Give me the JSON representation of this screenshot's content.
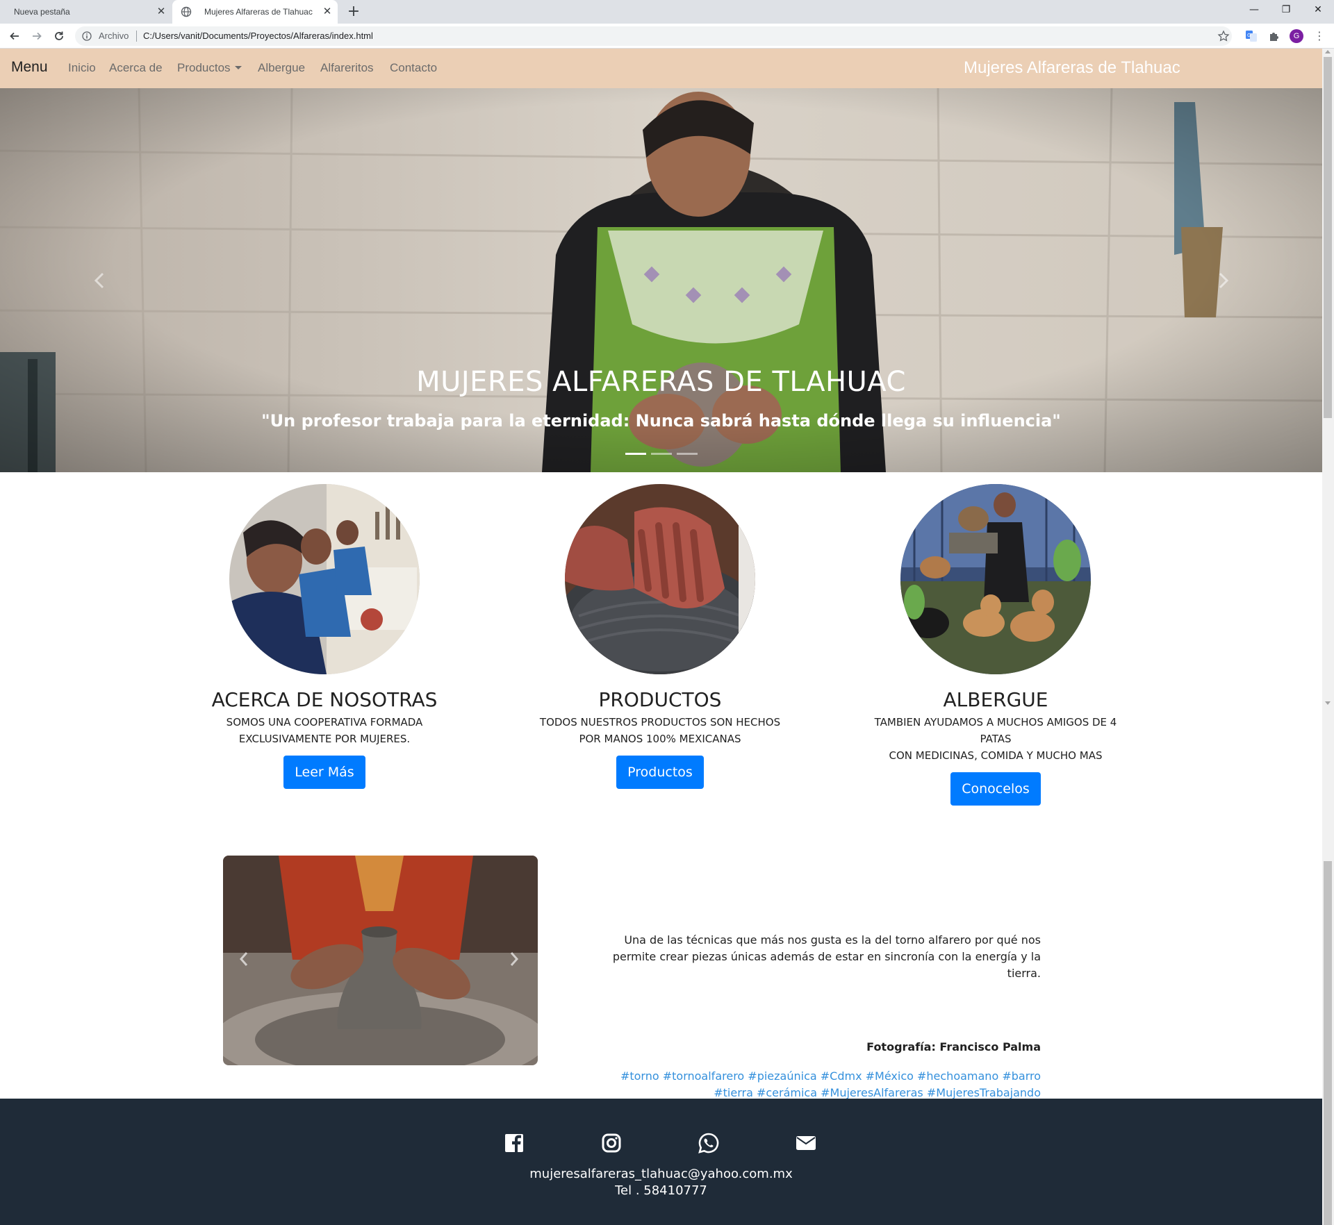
{
  "browser": {
    "tabs": [
      {
        "title": "Nueva pestaña"
      },
      {
        "title": "Mujeres Alfareras de Tlahuac"
      }
    ],
    "omnibox": {
      "scheme_label": "Archivo",
      "url": "C:/Users/vanit/Documents/Proyectos/Alfareras/index.html"
    },
    "profile_initial": "G"
  },
  "navbar": {
    "brand": "Menu",
    "links": [
      "Inicio",
      "Acerca de",
      "Productos",
      "Albergue",
      "Alfareritos",
      "Contacto"
    ],
    "site_title": "Mujeres Alfareras de Tlahuac",
    "background": "#ebcfb5"
  },
  "hero": {
    "title": "MUJERES ALFARERAS DE TLAHUAC",
    "quote": "\"Un profesor trabaja para la eternidad: Nunca sabrá hasta dónde llega su influencia\"",
    "slide_count": 3,
    "active_slide": 1
  },
  "features": [
    {
      "heading": "ACERCA DE NOSOTRAS",
      "lines": [
        "SOMOS UNA COOPERATIVA FORMADA",
        "EXCLUSIVAMENTE POR MUJERES."
      ],
      "button": "Leer Más"
    },
    {
      "heading": "PRODUCTOS",
      "lines": [
        "TODOS NUESTROS PRODUCTOS SON HECHOS",
        "POR MANOS 100% MEXICANAS"
      ],
      "button": "Productos"
    },
    {
      "heading": "ALBERGUE",
      "lines": [
        "TAMBIEN AYUDAMOS A MUCHOS AMIGOS DE 4",
        "PATAS",
        "CON MEDICINAS, COMIDA Y MUCHO MAS"
      ],
      "button": "Conocelos"
    }
  ],
  "technique": {
    "lines": [
      "Una de las técnicas que más nos gusta es la del torno alfarero por qué nos",
      "permite crear piezas únicas además de estar en sincronía con la energía y la",
      "tierra."
    ],
    "credit": "Fotografía: Francisco Palma",
    "hashtags_line1": "#torno #tornoalfarero #piezaúnica #Cdmx #México #hechoamano #barro",
    "hashtags_line2": "#tierra #cerámica #MujeresAlfareras #MujeresTrabajando"
  },
  "footer": {
    "email": "mujeresalfareras_tlahuac@yahoo.com.mx",
    "phone": "Tel . 58410777",
    "social_icons": [
      "facebook-icon",
      "instagram-icon",
      "whatsapp-icon",
      "mail-icon"
    ]
  },
  "colors": {
    "primary_button": "#007bff",
    "footer_bg": "#1f2b38",
    "hashtag": "#3490dc"
  }
}
